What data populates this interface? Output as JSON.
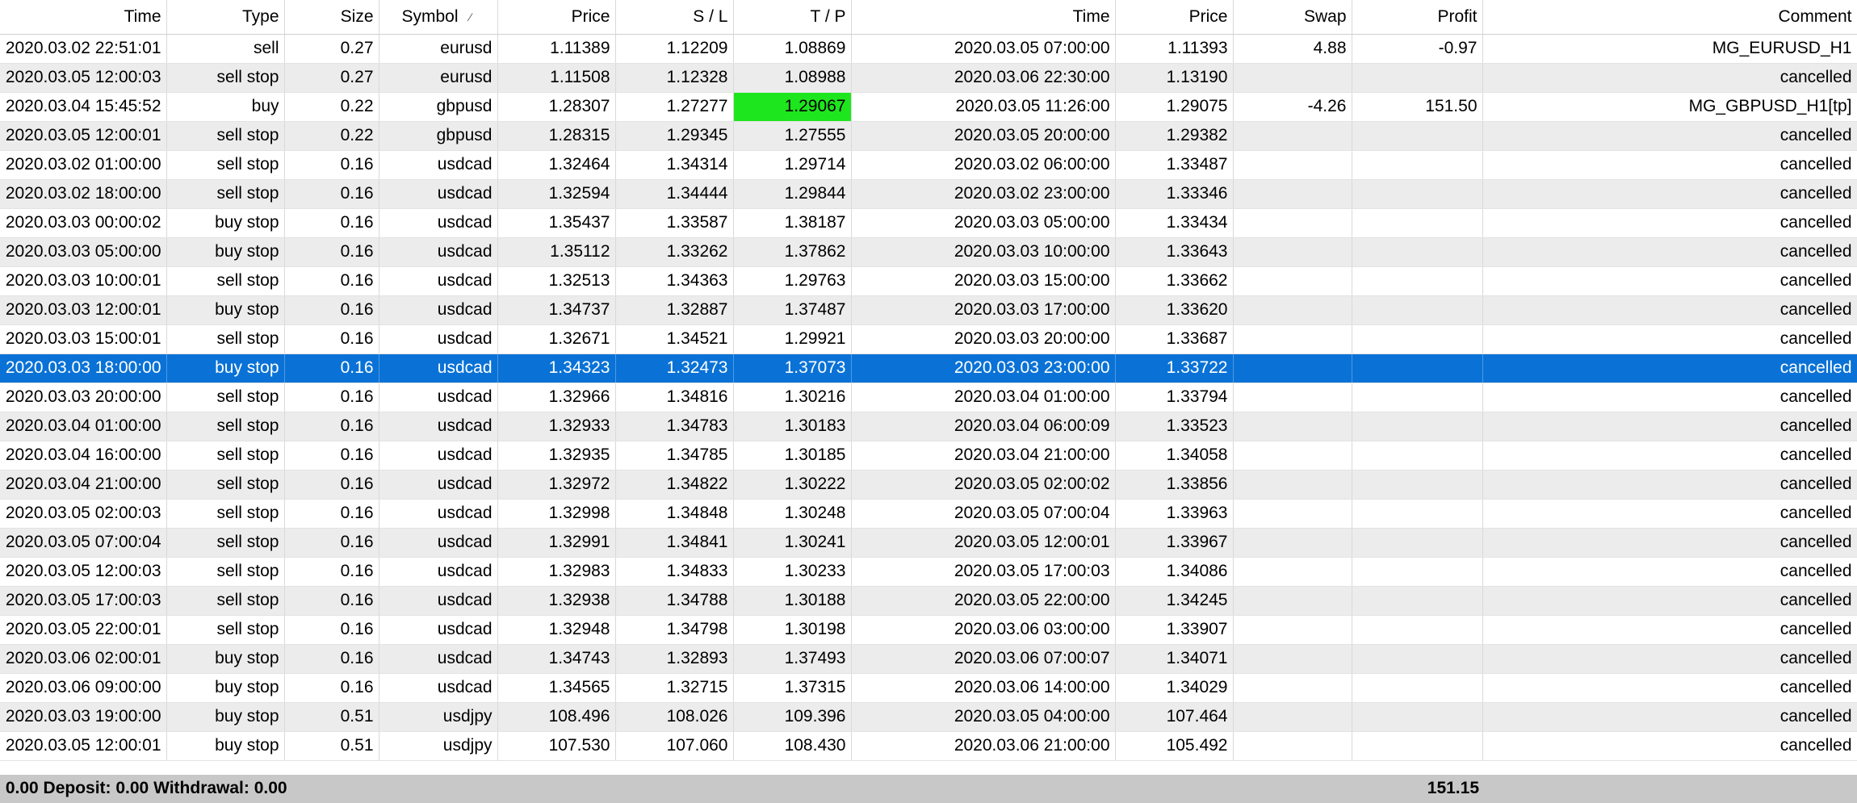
{
  "columns": [
    {
      "key": "time_open",
      "label": "Time"
    },
    {
      "key": "type",
      "label": "Type"
    },
    {
      "key": "size",
      "label": "Size"
    },
    {
      "key": "symbol",
      "label": "Symbol"
    },
    {
      "key": "price_open",
      "label": "Price"
    },
    {
      "key": "sl",
      "label": "S / L"
    },
    {
      "key": "tp",
      "label": "T / P"
    },
    {
      "key": "time_close",
      "label": "Time"
    },
    {
      "key": "price_close",
      "label": "Price"
    },
    {
      "key": "swap",
      "label": "Swap"
    },
    {
      "key": "profit",
      "label": "Profit"
    },
    {
      "key": "comment",
      "label": "Comment"
    }
  ],
  "sort_indicator": "⁄",
  "colors": {
    "selected_row": "#0a72d6",
    "tp_hit": "#1ee61e",
    "alt_row": "#ececec",
    "footer": "#c8c8c8"
  },
  "rows": [
    {
      "time_open": "2020.03.02 22:51:01",
      "type": "sell",
      "size": "0.27",
      "symbol": "eurusd",
      "price_open": "1.11389",
      "sl": "1.12209",
      "tp": "1.08869",
      "time_close": "2020.03.05 07:00:00",
      "price_close": "1.11393",
      "swap": "4.88",
      "profit": "-0.97",
      "comment": "MG_EURUSD_H1"
    },
    {
      "time_open": "2020.03.05 12:00:03",
      "type": "sell stop",
      "size": "0.27",
      "symbol": "eurusd",
      "price_open": "1.11508",
      "sl": "1.12328",
      "tp": "1.08988",
      "time_close": "2020.03.06 22:30:00",
      "price_close": "1.13190",
      "swap": "",
      "profit": "",
      "comment": "cancelled"
    },
    {
      "time_open": "2020.03.04 15:45:52",
      "type": "buy",
      "size": "0.22",
      "symbol": "gbpusd",
      "price_open": "1.28307",
      "sl": "1.27277",
      "tp": "1.29067",
      "time_close": "2020.03.05 11:26:00",
      "price_close": "1.29075",
      "swap": "-4.26",
      "profit": "151.50",
      "comment": "MG_GBPUSD_H1[tp]",
      "tp_hit": true
    },
    {
      "time_open": "2020.03.05 12:00:01",
      "type": "sell stop",
      "size": "0.22",
      "symbol": "gbpusd",
      "price_open": "1.28315",
      "sl": "1.29345",
      "tp": "1.27555",
      "time_close": "2020.03.05 20:00:00",
      "price_close": "1.29382",
      "swap": "",
      "profit": "",
      "comment": "cancelled"
    },
    {
      "time_open": "2020.03.02 01:00:00",
      "type": "sell stop",
      "size": "0.16",
      "symbol": "usdcad",
      "price_open": "1.32464",
      "sl": "1.34314",
      "tp": "1.29714",
      "time_close": "2020.03.02 06:00:00",
      "price_close": "1.33487",
      "swap": "",
      "profit": "",
      "comment": "cancelled"
    },
    {
      "time_open": "2020.03.02 18:00:00",
      "type": "sell stop",
      "size": "0.16",
      "symbol": "usdcad",
      "price_open": "1.32594",
      "sl": "1.34444",
      "tp": "1.29844",
      "time_close": "2020.03.02 23:00:00",
      "price_close": "1.33346",
      "swap": "",
      "profit": "",
      "comment": "cancelled"
    },
    {
      "time_open": "2020.03.03 00:00:02",
      "type": "buy stop",
      "size": "0.16",
      "symbol": "usdcad",
      "price_open": "1.35437",
      "sl": "1.33587",
      "tp": "1.38187",
      "time_close": "2020.03.03 05:00:00",
      "price_close": "1.33434",
      "swap": "",
      "profit": "",
      "comment": "cancelled"
    },
    {
      "time_open": "2020.03.03 05:00:00",
      "type": "buy stop",
      "size": "0.16",
      "symbol": "usdcad",
      "price_open": "1.35112",
      "sl": "1.33262",
      "tp": "1.37862",
      "time_close": "2020.03.03 10:00:00",
      "price_close": "1.33643",
      "swap": "",
      "profit": "",
      "comment": "cancelled"
    },
    {
      "time_open": "2020.03.03 10:00:01",
      "type": "sell stop",
      "size": "0.16",
      "symbol": "usdcad",
      "price_open": "1.32513",
      "sl": "1.34363",
      "tp": "1.29763",
      "time_close": "2020.03.03 15:00:00",
      "price_close": "1.33662",
      "swap": "",
      "profit": "",
      "comment": "cancelled"
    },
    {
      "time_open": "2020.03.03 12:00:01",
      "type": "buy stop",
      "size": "0.16",
      "symbol": "usdcad",
      "price_open": "1.34737",
      "sl": "1.32887",
      "tp": "1.37487",
      "time_close": "2020.03.03 17:00:00",
      "price_close": "1.33620",
      "swap": "",
      "profit": "",
      "comment": "cancelled"
    },
    {
      "time_open": "2020.03.03 15:00:01",
      "type": "sell stop",
      "size": "0.16",
      "symbol": "usdcad",
      "price_open": "1.32671",
      "sl": "1.34521",
      "tp": "1.29921",
      "time_close": "2020.03.03 20:00:00",
      "price_close": "1.33687",
      "swap": "",
      "profit": "",
      "comment": "cancelled"
    },
    {
      "time_open": "2020.03.03 18:00:00",
      "type": "buy stop",
      "size": "0.16",
      "symbol": "usdcad",
      "price_open": "1.34323",
      "sl": "1.32473",
      "tp": "1.37073",
      "time_close": "2020.03.03 23:00:00",
      "price_close": "1.33722",
      "swap": "",
      "profit": "",
      "comment": "cancelled",
      "selected": true
    },
    {
      "time_open": "2020.03.03 20:00:00",
      "type": "sell stop",
      "size": "0.16",
      "symbol": "usdcad",
      "price_open": "1.32966",
      "sl": "1.34816",
      "tp": "1.30216",
      "time_close": "2020.03.04 01:00:00",
      "price_close": "1.33794",
      "swap": "",
      "profit": "",
      "comment": "cancelled"
    },
    {
      "time_open": "2020.03.04 01:00:00",
      "type": "sell stop",
      "size": "0.16",
      "symbol": "usdcad",
      "price_open": "1.32933",
      "sl": "1.34783",
      "tp": "1.30183",
      "time_close": "2020.03.04 06:00:09",
      "price_close": "1.33523",
      "swap": "",
      "profit": "",
      "comment": "cancelled"
    },
    {
      "time_open": "2020.03.04 16:00:00",
      "type": "sell stop",
      "size": "0.16",
      "symbol": "usdcad",
      "price_open": "1.32935",
      "sl": "1.34785",
      "tp": "1.30185",
      "time_close": "2020.03.04 21:00:00",
      "price_close": "1.34058",
      "swap": "",
      "profit": "",
      "comment": "cancelled"
    },
    {
      "time_open": "2020.03.04 21:00:00",
      "type": "sell stop",
      "size": "0.16",
      "symbol": "usdcad",
      "price_open": "1.32972",
      "sl": "1.34822",
      "tp": "1.30222",
      "time_close": "2020.03.05 02:00:02",
      "price_close": "1.33856",
      "swap": "",
      "profit": "",
      "comment": "cancelled"
    },
    {
      "time_open": "2020.03.05 02:00:03",
      "type": "sell stop",
      "size": "0.16",
      "symbol": "usdcad",
      "price_open": "1.32998",
      "sl": "1.34848",
      "tp": "1.30248",
      "time_close": "2020.03.05 07:00:04",
      "price_close": "1.33963",
      "swap": "",
      "profit": "",
      "comment": "cancelled"
    },
    {
      "time_open": "2020.03.05 07:00:04",
      "type": "sell stop",
      "size": "0.16",
      "symbol": "usdcad",
      "price_open": "1.32991",
      "sl": "1.34841",
      "tp": "1.30241",
      "time_close": "2020.03.05 12:00:01",
      "price_close": "1.33967",
      "swap": "",
      "profit": "",
      "comment": "cancelled"
    },
    {
      "time_open": "2020.03.05 12:00:03",
      "type": "sell stop",
      "size": "0.16",
      "symbol": "usdcad",
      "price_open": "1.32983",
      "sl": "1.34833",
      "tp": "1.30233",
      "time_close": "2020.03.05 17:00:03",
      "price_close": "1.34086",
      "swap": "",
      "profit": "",
      "comment": "cancelled"
    },
    {
      "time_open": "2020.03.05 17:00:03",
      "type": "sell stop",
      "size": "0.16",
      "symbol": "usdcad",
      "price_open": "1.32938",
      "sl": "1.34788",
      "tp": "1.30188",
      "time_close": "2020.03.05 22:00:00",
      "price_close": "1.34245",
      "swap": "",
      "profit": "",
      "comment": "cancelled"
    },
    {
      "time_open": "2020.03.05 22:00:01",
      "type": "sell stop",
      "size": "0.16",
      "symbol": "usdcad",
      "price_open": "1.32948",
      "sl": "1.34798",
      "tp": "1.30198",
      "time_close": "2020.03.06 03:00:00",
      "price_close": "1.33907",
      "swap": "",
      "profit": "",
      "comment": "cancelled"
    },
    {
      "time_open": "2020.03.06 02:00:01",
      "type": "buy stop",
      "size": "0.16",
      "symbol": "usdcad",
      "price_open": "1.34743",
      "sl": "1.32893",
      "tp": "1.37493",
      "time_close": "2020.03.06 07:00:07",
      "price_close": "1.34071",
      "swap": "",
      "profit": "",
      "comment": "cancelled"
    },
    {
      "time_open": "2020.03.06 09:00:00",
      "type": "buy stop",
      "size": "0.16",
      "symbol": "usdcad",
      "price_open": "1.34565",
      "sl": "1.32715",
      "tp": "1.37315",
      "time_close": "2020.03.06 14:00:00",
      "price_close": "1.34029",
      "swap": "",
      "profit": "",
      "comment": "cancelled"
    },
    {
      "time_open": "2020.03.03 19:00:00",
      "type": "buy stop",
      "size": "0.51",
      "symbol": "usdjpy",
      "price_open": "108.496",
      "sl": "108.026",
      "tp": "109.396",
      "time_close": "2020.03.05 04:00:00",
      "price_close": "107.464",
      "swap": "",
      "profit": "",
      "comment": "cancelled"
    },
    {
      "time_open": "2020.03.05 12:00:01",
      "type": "buy stop",
      "size": "0.51",
      "symbol": "usdjpy",
      "price_open": "107.530",
      "sl": "107.060",
      "tp": "108.430",
      "time_close": "2020.03.06 21:00:00",
      "price_close": "105.492",
      "swap": "",
      "profit": "",
      "comment": "cancelled"
    }
  ],
  "footer": {
    "summary": ": 0.00  Deposit: 0.00  Withdrawal: 0.00",
    "total_profit": "151.15"
  }
}
